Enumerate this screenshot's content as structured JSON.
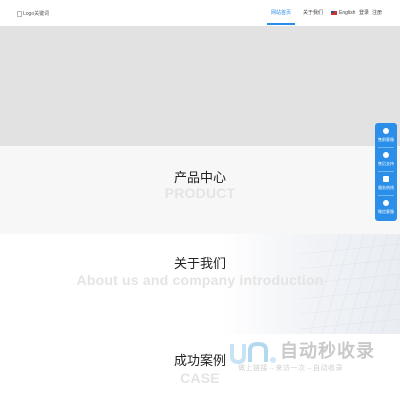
{
  "header": {
    "logo_text": "Logo关键词",
    "nav": [
      {
        "label": "网站首页",
        "active": true
      },
      {
        "label": "关于我们",
        "active": false
      }
    ],
    "language": "English",
    "login": "登录",
    "register": "注册"
  },
  "sections": {
    "product": {
      "title_cn": "产品中心",
      "title_en": "PRODUCT"
    },
    "about": {
      "title_cn": "关于我们",
      "title_en": "About us and company introduction"
    },
    "case": {
      "title_cn": "成功案例",
      "title_en": "CASE"
    }
  },
  "float_toolbar": {
    "items": [
      {
        "label": "售前客服",
        "icon": "chat-icon"
      },
      {
        "label": "售后支持",
        "icon": "support-icon"
      },
      {
        "label": "服务热线",
        "icon": "phone-icon"
      },
      {
        "label": "微信客服",
        "icon": "wechat-icon"
      }
    ]
  },
  "watermark": {
    "title": "自动秒收录",
    "subtitle": "做上链接→来访一次→自动收录"
  },
  "colors": {
    "accent": "#2a8be8",
    "banner": "#e2e2e2",
    "float_bar": "#2b8fe9"
  }
}
